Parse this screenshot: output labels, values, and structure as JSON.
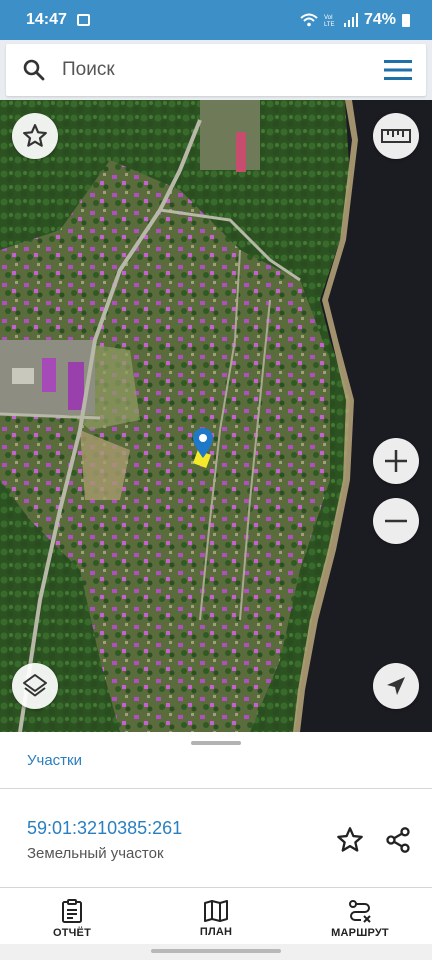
{
  "status_bar": {
    "time": "14:47",
    "battery": "74%",
    "icons": [
      "gallery-icon",
      "wifi-icon",
      "volte-icon",
      "signal-icon",
      "battery-icon"
    ]
  },
  "search": {
    "placeholder": "Поиск"
  },
  "map": {
    "buttons": [
      "star-icon",
      "ruler-icon",
      "zoom-in-icon",
      "zoom-out-icon",
      "layers-icon",
      "locate-icon"
    ],
    "marker": "map-pin-icon"
  },
  "sheet": {
    "tab_label": "Участки",
    "parcel": {
      "cadastral_number": "59:01:3210385:261",
      "type": "Земельный участок"
    }
  },
  "bottom_nav": {
    "items": [
      {
        "label": "ОТЧЁТ",
        "icon": "clipboard-icon"
      },
      {
        "label": "ПЛАН",
        "icon": "map-icon"
      },
      {
        "label": "МАРШРУТ",
        "icon": "route-icon"
      }
    ]
  },
  "colors": {
    "status_bar": "#3c8fc7",
    "accent": "#2a7fc0",
    "menu_icon": "#1f6fa8"
  }
}
